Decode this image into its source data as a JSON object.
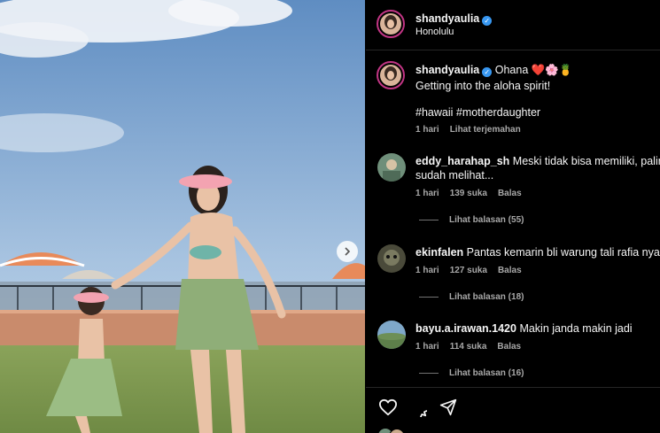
{
  "header": {
    "username": "shandyaulia",
    "location": "Honolulu"
  },
  "caption": {
    "username": "shandyaulia",
    "text_line1": "Ohana ❤️🌸🍍",
    "text_line2": "Getting into the aloha spirit!",
    "hashtags": "#hawaii #motherdaughter",
    "time": "1 hari",
    "translate": "Lihat terjemahan"
  },
  "comments": [
    {
      "username": "eddy_harahap_sh",
      "text_line1": "Meski tidak bisa memiliki, palin",
      "text_line2": "sudah melihat...",
      "time": "1 hari",
      "likes": "139 suka",
      "reply": "Balas",
      "view_replies": "Lihat balasan (55)"
    },
    {
      "username": "ekinfalen",
      "text_line1": "Pantas kemarin bli warung tali rafia nya",
      "time": "1 hari",
      "likes": "127 suka",
      "reply": "Balas",
      "view_replies": "Lihat balasan (18)"
    },
    {
      "username": "bayu.a.irawan.1420",
      "text_line1": "Makin janda makin jadi",
      "time": "1 hari",
      "likes": "114 suka",
      "reply": "Balas",
      "view_replies": "Lihat balasan (16)"
    }
  ],
  "icons": {
    "like": "heart-icon",
    "comment": "comment-icon",
    "share": "send-icon",
    "next": "chevron-right-icon",
    "verified": "verified-badge-icon"
  },
  "colors": {
    "background": "#000000",
    "verified": "#3897f0",
    "muted_text": "#a8a8a8",
    "story_ring": "#c13584"
  }
}
